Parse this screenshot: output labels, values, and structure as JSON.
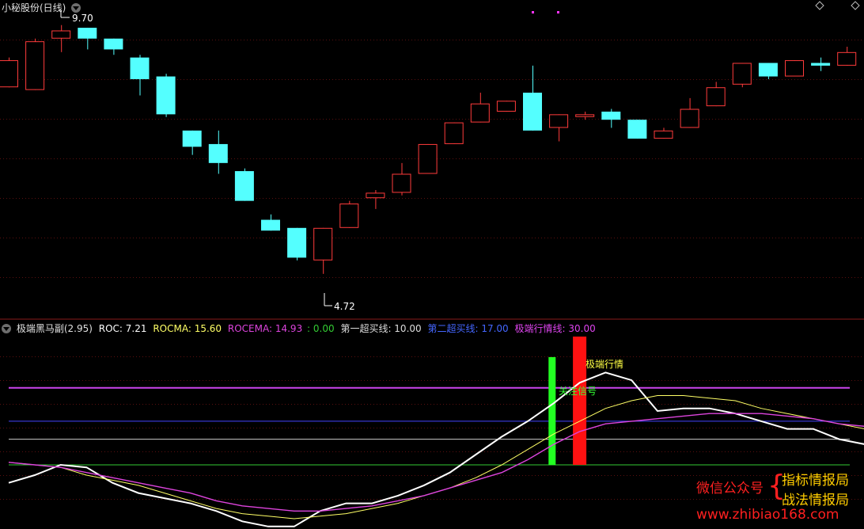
{
  "header": {
    "title": "小秘股份(日线)",
    "indicator_name": "极端黑马副(2.95)",
    "roc_label": "ROC: 7.21",
    "rocma_label": "ROCMA: 15.60",
    "rocema_label": "ROCEMA: 14.93",
    "zero_label": ": 0.00",
    "buy1_label": "第一超买线: 10.00",
    "buy2_label": "第二超买线: 17.00",
    "extreme_label": "极端行情线: 30.00"
  },
  "annotations": {
    "high_label": "9.70",
    "low_label": "4.72",
    "green_bar_label": "关注信号",
    "red_bar_label": "极端行情"
  },
  "watermark": {
    "left": "微信公众号",
    "brace": "{",
    "right_top": "指标情报局",
    "right_bottom": "战法情报局",
    "url": "www.zhibiao168.com"
  },
  "colors": {
    "up": "#ff3b3b",
    "down": "#54ffff",
    "roc": "#ffffff",
    "rocma": "#ffff66",
    "rocema": "#dd44dd",
    "zero_line": "#33cc33",
    "buy1_line": "#cccccc",
    "buy2_line": "#4444ff",
    "extreme_line": "#cc44ee",
    "green_bar": "#22ff22",
    "red_bar": "#ff1111"
  },
  "chart_data": [
    {
      "type": "candlestick",
      "ylim": [
        4.6,
        9.9
      ],
      "candles": [
        {
          "o": 8.55,
          "c": 9.05,
          "h": 9.1,
          "l": 8.55
        },
        {
          "o": 8.5,
          "c": 9.4,
          "h": 9.45,
          "l": 8.5
        },
        {
          "o": 9.45,
          "c": 9.6,
          "h": 9.7,
          "l": 9.2
        },
        {
          "o": 9.65,
          "c": 9.45,
          "h": 9.65,
          "l": 9.25
        },
        {
          "o": 9.45,
          "c": 9.25,
          "h": 9.45,
          "l": 9.15
        },
        {
          "o": 9.1,
          "c": 8.7,
          "h": 9.15,
          "l": 8.4
        },
        {
          "o": 8.75,
          "c": 8.05,
          "h": 8.8,
          "l": 8.0
        },
        {
          "o": 7.75,
          "c": 7.45,
          "h": 7.75,
          "l": 7.3
        },
        {
          "o": 7.5,
          "c": 7.15,
          "h": 7.75,
          "l": 6.95
        },
        {
          "o": 7.0,
          "c": 6.45,
          "h": 7.05,
          "l": 6.45
        },
        {
          "o": 6.1,
          "c": 5.9,
          "h": 6.2,
          "l": 5.9
        },
        {
          "o": 5.95,
          "c": 5.4,
          "h": 5.95,
          "l": 5.35
        },
        {
          "o": 5.35,
          "c": 5.95,
          "h": 5.95,
          "l": 5.1
        },
        {
          "o": 5.95,
          "c": 6.4,
          "h": 6.45,
          "l": 5.95
        },
        {
          "o": 6.5,
          "c": 6.6,
          "h": 6.65,
          "l": 6.3
        },
        {
          "o": 6.6,
          "c": 6.95,
          "h": 7.15,
          "l": 6.55
        },
        {
          "o": 6.95,
          "c": 7.5,
          "h": 7.5,
          "l": 6.95
        },
        {
          "o": 7.5,
          "c": 7.9,
          "h": 7.9,
          "l": 7.5
        },
        {
          "o": 7.9,
          "c": 8.25,
          "h": 8.45,
          "l": 7.9
        },
        {
          "o": 8.1,
          "c": 8.3,
          "h": 8.3,
          "l": 8.1
        },
        {
          "o": 8.45,
          "c": 7.75,
          "h": 8.95,
          "l": 7.75
        },
        {
          "o": 7.8,
          "c": 8.05,
          "h": 8.05,
          "l": 7.55
        },
        {
          "o": 8.0,
          "c": 8.05,
          "h": 8.1,
          "l": 7.95
        },
        {
          "o": 8.1,
          "c": 7.95,
          "h": 8.15,
          "l": 7.8
        },
        {
          "o": 7.95,
          "c": 7.6,
          "h": 7.95,
          "l": 7.6
        },
        {
          "o": 7.6,
          "c": 7.75,
          "h": 7.8,
          "l": 7.6
        },
        {
          "o": 7.8,
          "c": 8.15,
          "h": 8.35,
          "l": 7.8
        },
        {
          "o": 8.2,
          "c": 8.55,
          "h": 8.65,
          "l": 8.2
        },
        {
          "o": 8.6,
          "c": 9.0,
          "h": 9.0,
          "l": 8.55
        },
        {
          "o": 9.0,
          "c": 8.75,
          "h": 9.0,
          "l": 8.7
        },
        {
          "o": 8.75,
          "c": 9.05,
          "h": 9.05,
          "l": 8.75
        },
        {
          "o": 9.0,
          "c": 8.95,
          "h": 9.1,
          "l": 8.85
        },
        {
          "o": 8.95,
          "c": 9.2,
          "h": 9.3,
          "l": 8.95
        }
      ]
    },
    {
      "type": "line",
      "ylim": [
        -25,
        50
      ],
      "x": [
        0,
        1,
        2,
        3,
        4,
        5,
        6,
        7,
        8,
        9,
        10,
        11,
        12,
        13,
        14,
        15,
        16,
        17,
        18,
        19,
        20,
        21,
        22,
        23,
        24,
        25,
        26,
        27,
        28,
        29,
        30,
        31,
        32,
        33
      ],
      "series": [
        {
          "name": "ROC",
          "values": [
            -7.0,
            -4.0,
            0.0,
            -1.0,
            -7.0,
            -11.0,
            -13.0,
            -15.0,
            -18.0,
            -22.0,
            -24.0,
            -24.0,
            -18.0,
            -15.0,
            -15.0,
            -12.0,
            -8.0,
            -3.0,
            4.0,
            11.0,
            17.0,
            24.0,
            32.0,
            36.0,
            33.0,
            21.0,
            22.0,
            22.0,
            20.0,
            17.0,
            14.0,
            14.0,
            10.0,
            8.0
          ]
        },
        {
          "name": "ROCMA",
          "values": [
            1.0,
            0.0,
            -1.0,
            -4.0,
            -6.0,
            -8.0,
            -11.0,
            -14.0,
            -17.0,
            -19.0,
            -20.0,
            -21.0,
            -20.0,
            -19.0,
            -17.0,
            -15.0,
            -12.0,
            -9.0,
            -5.0,
            0.0,
            6.0,
            12.0,
            17.0,
            22.0,
            25.0,
            27.0,
            27.0,
            26.0,
            25.0,
            22.0,
            20.0,
            18.0,
            16.0,
            14.0
          ]
        },
        {
          "name": "ROCEMA",
          "values": [
            1.0,
            0.0,
            -1.0,
            -3.0,
            -5.0,
            -7.0,
            -9.0,
            -11.0,
            -14.0,
            -16.0,
            -17.0,
            -18.0,
            -18.0,
            -17.0,
            -16.0,
            -14.0,
            -12.0,
            -9.0,
            -6.0,
            -3.0,
            2.0,
            8.0,
            13.0,
            16.0,
            17.0,
            18.0,
            19.0,
            20.0,
            20.0,
            20.0,
            19.0,
            18.0,
            16.0,
            15.0
          ]
        }
      ],
      "reference_lines": [
        {
          "value": 0,
          "label": "0.00"
        },
        {
          "value": 10,
          "label": "第一超买线"
        },
        {
          "value": 17,
          "label": "第二超买线"
        },
        {
          "value": 30,
          "label": "极端行情线"
        }
      ],
      "signal_bars": [
        {
          "x": 21,
          "from": 0,
          "to": 42,
          "label": "关注信号"
        },
        {
          "x": 22,
          "from": 0,
          "to": 50,
          "label": "极端行情"
        }
      ]
    }
  ]
}
